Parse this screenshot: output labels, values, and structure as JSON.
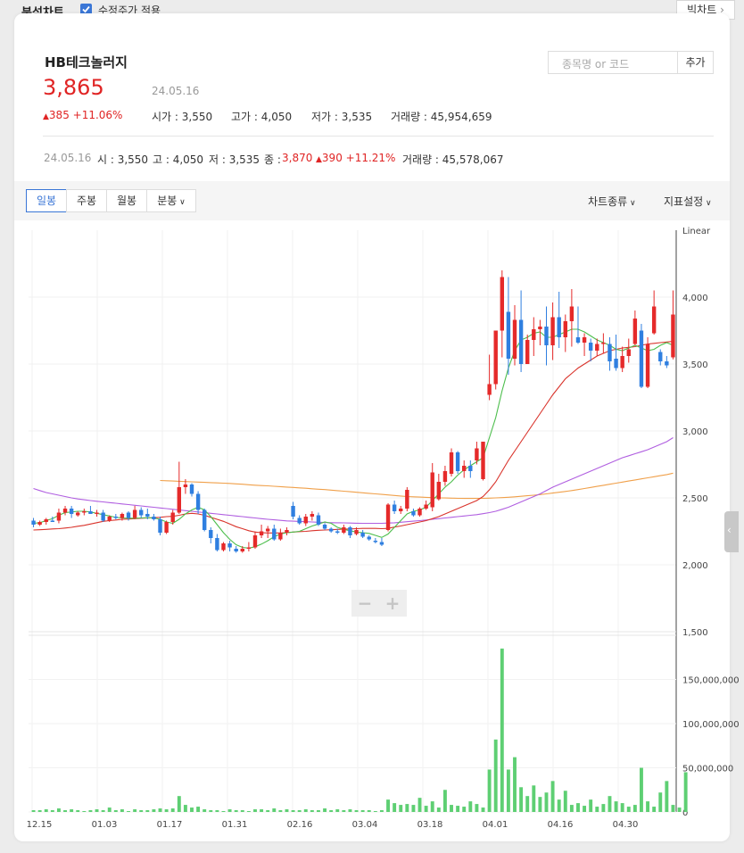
{
  "header": {
    "title": "분석차트",
    "adjusted_label": "수정주가 적용",
    "adjusted_checked": true,
    "big_chart_label": "빅차트",
    "big_chart_icon": "chevron-right-icon"
  },
  "stock": {
    "name": "HB테크놀러지",
    "price": "3,865",
    "date": "24.05.16",
    "change": "385 +11.06%",
    "open_label": "시가 : 3,550",
    "high_label": "고가 : 4,050",
    "low_label": "저가 : 3,535",
    "volume_label": "거래량 : 45,954,659"
  },
  "search": {
    "placeholder": "종목명 or 코드",
    "add_label": "추가"
  },
  "candle_info": {
    "date": "24.05.16",
    "open": "시 : 3,550",
    "high": "고 : 4,050",
    "low": "저 : 3,535",
    "close_label": "종 :",
    "close_value": "3,870",
    "change": "390 +11.21%",
    "volume": "거래량 : 45,578,067"
  },
  "tabs": [
    "일봉",
    "주봉",
    "월봉",
    "분봉"
  ],
  "active_tab": "일봉",
  "dropdowns": {
    "chart_type": "차트종류",
    "indicator": "지표설정"
  },
  "colors": {
    "up": "#e52a2a",
    "down": "#2f7fe0",
    "ma5": "#4cbe4c",
    "ma20": "#d9332b",
    "ma60": "#b05ee0",
    "ma120": "#f0a04a",
    "volume": "#5ecf73",
    "accent": "#3a76d6"
  },
  "chart_data": {
    "type": "candlestick",
    "scale_label": "Linear",
    "price_ticks": [
      "4,000",
      "3,500",
      "3,000",
      "2,500",
      "2,000",
      "1,500"
    ],
    "volume_ticks": [
      "150,000,000",
      "100,000,000",
      "50,000,000",
      "0"
    ],
    "x_labels": [
      "12.15",
      "01.03",
      "01.17",
      "01.31",
      "02.16",
      "03.04",
      "03.18",
      "04.01",
      "04.16",
      "04.30"
    ],
    "price_range": [
      1500,
      4500
    ],
    "volume_range": [
      0,
      200000000
    ],
    "candles": [
      [
        2330,
        2350,
        2280,
        2300
      ],
      [
        2300,
        2330,
        2290,
        2320
      ],
      [
        2320,
        2350,
        2300,
        2340
      ],
      [
        2330,
        2360,
        2320,
        2320
      ],
      [
        2330,
        2420,
        2310,
        2390
      ],
      [
        2390,
        2440,
        2370,
        2420
      ],
      [
        2420,
        2440,
        2350,
        2380
      ],
      [
        2370,
        2400,
        2360,
        2390
      ],
      [
        2390,
        2420,
        2370,
        2400
      ],
      [
        2400,
        2440,
        2380,
        2380
      ],
      [
        2380,
        2410,
        2360,
        2390
      ],
      [
        2390,
        2410,
        2320,
        2330
      ],
      [
        2330,
        2370,
        2320,
        2360
      ],
      [
        2360,
        2380,
        2340,
        2350
      ],
      [
        2350,
        2390,
        2330,
        2380
      ],
      [
        2390,
        2400,
        2330,
        2350
      ],
      [
        2350,
        2440,
        2340,
        2410
      ],
      [
        2410,
        2430,
        2350,
        2370
      ],
      [
        2380,
        2420,
        2340,
        2360
      ],
      [
        2360,
        2380,
        2330,
        2340
      ],
      [
        2340,
        2360,
        2220,
        2240
      ],
      [
        2240,
        2330,
        2230,
        2320
      ],
      [
        2320,
        2410,
        2300,
        2390
      ],
      [
        2390,
        2770,
        2380,
        2580
      ],
      [
        2580,
        2640,
        2530,
        2600
      ],
      [
        2600,
        2610,
        2510,
        2530
      ],
      [
        2530,
        2550,
        2380,
        2410
      ],
      [
        2410,
        2420,
        2250,
        2260
      ],
      [
        2260,
        2280,
        2160,
        2200
      ],
      [
        2200,
        2230,
        2100,
        2110
      ],
      [
        2110,
        2170,
        2100,
        2160
      ],
      [
        2160,
        2180,
        2100,
        2130
      ],
      [
        2120,
        2140,
        2090,
        2100
      ],
      [
        2100,
        2140,
        2090,
        2120
      ],
      [
        2120,
        2170,
        2100,
        2130
      ],
      [
        2130,
        2250,
        2120,
        2220
      ],
      [
        2220,
        2300,
        2200,
        2250
      ],
      [
        2250,
        2290,
        2200,
        2270
      ],
      [
        2270,
        2300,
        2180,
        2190
      ],
      [
        2190,
        2270,
        2180,
        2240
      ],
      [
        2240,
        2280,
        2220,
        2260
      ],
      [
        2440,
        2470,
        2340,
        2360
      ],
      [
        2350,
        2370,
        2300,
        2310
      ],
      [
        2310,
        2380,
        2290,
        2360
      ],
      [
        2360,
        2400,
        2330,
        2380
      ],
      [
        2370,
        2390,
        2290,
        2300
      ],
      [
        2300,
        2310,
        2260,
        2270
      ],
      [
        2270,
        2280,
        2240,
        2250
      ],
      [
        2250,
        2270,
        2230,
        2240
      ],
      [
        2240,
        2300,
        2230,
        2280
      ],
      [
        2280,
        2290,
        2200,
        2220
      ],
      [
        2230,
        2280,
        2220,
        2260
      ],
      [
        2240,
        2260,
        2200,
        2210
      ],
      [
        2210,
        2220,
        2180,
        2190
      ],
      [
        2180,
        2200,
        2160,
        2170
      ],
      [
        2170,
        2200,
        2140,
        2150
      ],
      [
        2260,
        2460,
        2250,
        2450
      ],
      [
        2450,
        2480,
        2380,
        2400
      ],
      [
        2400,
        2440,
        2380,
        2420
      ],
      [
        2420,
        2580,
        2400,
        2560
      ],
      [
        2400,
        2420,
        2360,
        2370
      ],
      [
        2370,
        2430,
        2360,
        2420
      ],
      [
        2420,
        2480,
        2410,
        2450
      ],
      [
        2430,
        2760,
        2400,
        2690
      ],
      [
        2490,
        2680,
        2480,
        2620
      ],
      [
        2620,
        2740,
        2590,
        2700
      ],
      [
        2680,
        2870,
        2660,
        2840
      ],
      [
        2840,
        2850,
        2680,
        2700
      ],
      [
        2700,
        2780,
        2650,
        2740
      ],
      [
        2740,
        2780,
        2650,
        2700
      ],
      [
        2780,
        2920,
        2750,
        2870
      ],
      [
        2640,
        2920,
        2630,
        2920
      ],
      [
        3270,
        3570,
        3230,
        3350
      ],
      [
        3350,
        3620,
        3310,
        3750
      ],
      [
        3750,
        4200,
        3550,
        4150
      ],
      [
        3890,
        4150,
        3420,
        3540
      ],
      [
        3540,
        3940,
        3490,
        3830
      ],
      [
        3830,
        4050,
        3440,
        3500
      ],
      [
        3500,
        3720,
        3510,
        3680
      ],
      [
        3680,
        3850,
        3560,
        3760
      ],
      [
        3760,
        3830,
        3640,
        3780
      ],
      [
        3780,
        3930,
        3490,
        3640
      ],
      [
        3640,
        3960,
        3530,
        3850
      ],
      [
        3850,
        4040,
        3620,
        3700
      ],
      [
        3700,
        3870,
        3590,
        3820
      ],
      [
        3820,
        4060,
        3630,
        3930
      ],
      [
        3700,
        3930,
        3650,
        3660
      ],
      [
        3660,
        3730,
        3560,
        3700
      ],
      [
        3660,
        3690,
        3520,
        3600
      ],
      [
        3600,
        3690,
        3560,
        3650
      ],
      [
        3650,
        3730,
        3580,
        3660
      ],
      [
        3650,
        3700,
        3450,
        3520
      ],
      [
        3540,
        3720,
        3450,
        3470
      ],
      [
        3470,
        3630,
        3440,
        3560
      ],
      [
        3560,
        3690,
        3510,
        3610
      ],
      [
        3650,
        3900,
        3640,
        3840
      ],
      [
        3750,
        3800,
        3320,
        3330
      ],
      [
        3330,
        3700,
        3320,
        3650
      ],
      [
        3730,
        4050,
        3720,
        3930
      ],
      [
        3590,
        3610,
        3490,
        3520
      ],
      [
        3520,
        3560,
        3470,
        3490
      ],
      [
        3550,
        4050,
        3535,
        3870
      ]
    ],
    "volumes": [
      2,
      2,
      3,
      2,
      4,
      2,
      3,
      2,
      1,
      2,
      3,
      2,
      5,
      2,
      3,
      1,
      3,
      2,
      2,
      3,
      4,
      3,
      4,
      18,
      8,
      5,
      6,
      3,
      2,
      2,
      1,
      3,
      2,
      2,
      1,
      3,
      3,
      2,
      4,
      2,
      3,
      2,
      2,
      3,
      2,
      2,
      4,
      2,
      3,
      2,
      3,
      2,
      2,
      2,
      1,
      2,
      14,
      10,
      8,
      9,
      8,
      16,
      7,
      12,
      5,
      25,
      8,
      7,
      6,
      12,
      9,
      5,
      48,
      82,
      185,
      48,
      62,
      28,
      18,
      30,
      17,
      22,
      35,
      14,
      24,
      8,
      10,
      7,
      14,
      6,
      9,
      18,
      12,
      10,
      6,
      8,
      50,
      12,
      6,
      22,
      35,
      8,
      5,
      45
    ],
    "ma5": [
      2310,
      2315,
      2330,
      2345,
      2370,
      2390,
      2395,
      2400,
      2400,
      2395,
      2385,
      2375,
      2365,
      2355,
      2350,
      2348,
      2348,
      2350,
      2352,
      2350,
      2340,
      2320,
      2310,
      2340,
      2380,
      2410,
      2430,
      2410,
      2360,
      2300,
      2240,
      2190,
      2150,
      2130,
      2125,
      2135,
      2155,
      2180,
      2210,
      2230,
      2240,
      2245,
      2250,
      2270,
      2290,
      2305,
      2320,
      2310,
      2280,
      2265,
      2255,
      2245,
      2240,
      2235,
      2220,
      2205,
      2230,
      2280,
      2330,
      2380,
      2400,
      2410,
      2430,
      2480,
      2530,
      2580,
      2620,
      2670,
      2710,
      2740,
      2770,
      2800,
      2950,
      3100,
      3300,
      3470,
      3600,
      3680,
      3700,
      3730,
      3740,
      3700,
      3700,
      3720,
      3740,
      3760,
      3760,
      3740,
      3710,
      3680,
      3660,
      3640,
      3610,
      3600,
      3620,
      3640,
      3620,
      3600,
      3610,
      3640,
      3660,
      3640
    ],
    "ma20_start": 0,
    "ma20": [
      2260,
      2262,
      2265,
      2268,
      2270,
      2275,
      2280,
      2288,
      2295,
      2305,
      2315,
      2325,
      2330,
      2335,
      2340,
      2342,
      2345,
      2348,
      2350,
      2352,
      2355,
      2360,
      2362,
      2370,
      2380,
      2385,
      2380,
      2370,
      2355,
      2340,
      2325,
      2305,
      2285,
      2270,
      2255,
      2245,
      2240,
      2238,
      2238,
      2238,
      2240,
      2245,
      2248,
      2250,
      2255,
      2258,
      2260,
      2262,
      2265,
      2267,
      2268,
      2270,
      2272,
      2272,
      2272,
      2270,
      2272,
      2282,
      2290,
      2300,
      2310,
      2320,
      2330,
      2345,
      2360,
      2380,
      2400,
      2420,
      2440,
      2460,
      2480,
      2510,
      2560,
      2620,
      2700,
      2780,
      2850,
      2920,
      2990,
      3060,
      3130,
      3200,
      3270,
      3330,
      3390,
      3430,
      3470,
      3500,
      3530,
      3560,
      3580,
      3600,
      3610,
      3620,
      3625,
      3630,
      3640,
      3650,
      3655,
      3660,
      3665,
      3670
    ],
    "ma60": [
      2570,
      2555,
      2540,
      2530,
      2520,
      2510,
      2500,
      2492,
      2486,
      2480,
      2475,
      2470,
      2465,
      2460,
      2455,
      2450,
      2445,
      2440,
      2435,
      2430,
      2425,
      2420,
      2415,
      2410,
      2405,
      2400,
      2395,
      2390,
      2385,
      2380,
      2375,
      2370,
      2365,
      2360,
      2355,
      2350,
      2345,
      2340,
      2336,
      2332,
      2328,
      2326,
      2324,
      2322,
      2320,
      2318,
      2316,
      2315,
      2314,
      2313,
      2312,
      2311,
      2310,
      2310,
      2310,
      2310,
      2312,
      2314,
      2318,
      2322,
      2326,
      2330,
      2335,
      2340,
      2345,
      2350,
      2355,
      2360,
      2365,
      2370,
      2375,
      2382,
      2390,
      2400,
      2415,
      2430,
      2450,
      2470,
      2490,
      2510,
      2530,
      2555,
      2580,
      2600,
      2620,
      2640,
      2660,
      2680,
      2700,
      2720,
      2740,
      2760,
      2780,
      2800,
      2815,
      2830,
      2845,
      2860,
      2880,
      2900,
      2920,
      2950
    ],
    "ma120_start": 20,
    "ma120": [
      2630,
      2628,
      2626,
      2624,
      2622,
      2620,
      2618,
      2616,
      2614,
      2612,
      2610,
      2608,
      2605,
      2602,
      2598,
      2595,
      2592,
      2590,
      2587,
      2584,
      2581,
      2578,
      2575,
      2572,
      2568,
      2565,
      2562,
      2558,
      2554,
      2550,
      2546,
      2542,
      2538,
      2534,
      2530,
      2526,
      2522,
      2518,
      2514,
      2510,
      2508,
      2506,
      2504,
      2502,
      2500,
      2499,
      2498,
      2497,
      2496,
      2496,
      2496,
      2497,
      2498,
      2500,
      2502,
      2505,
      2508,
      2512,
      2516,
      2520,
      2525,
      2530,
      2536,
      2542,
      2548,
      2555,
      2562,
      2570,
      2578,
      2586,
      2594,
      2602,
      2610,
      2618,
      2626,
      2634,
      2642,
      2650,
      2658,
      2666,
      2674,
      2685
    ]
  }
}
